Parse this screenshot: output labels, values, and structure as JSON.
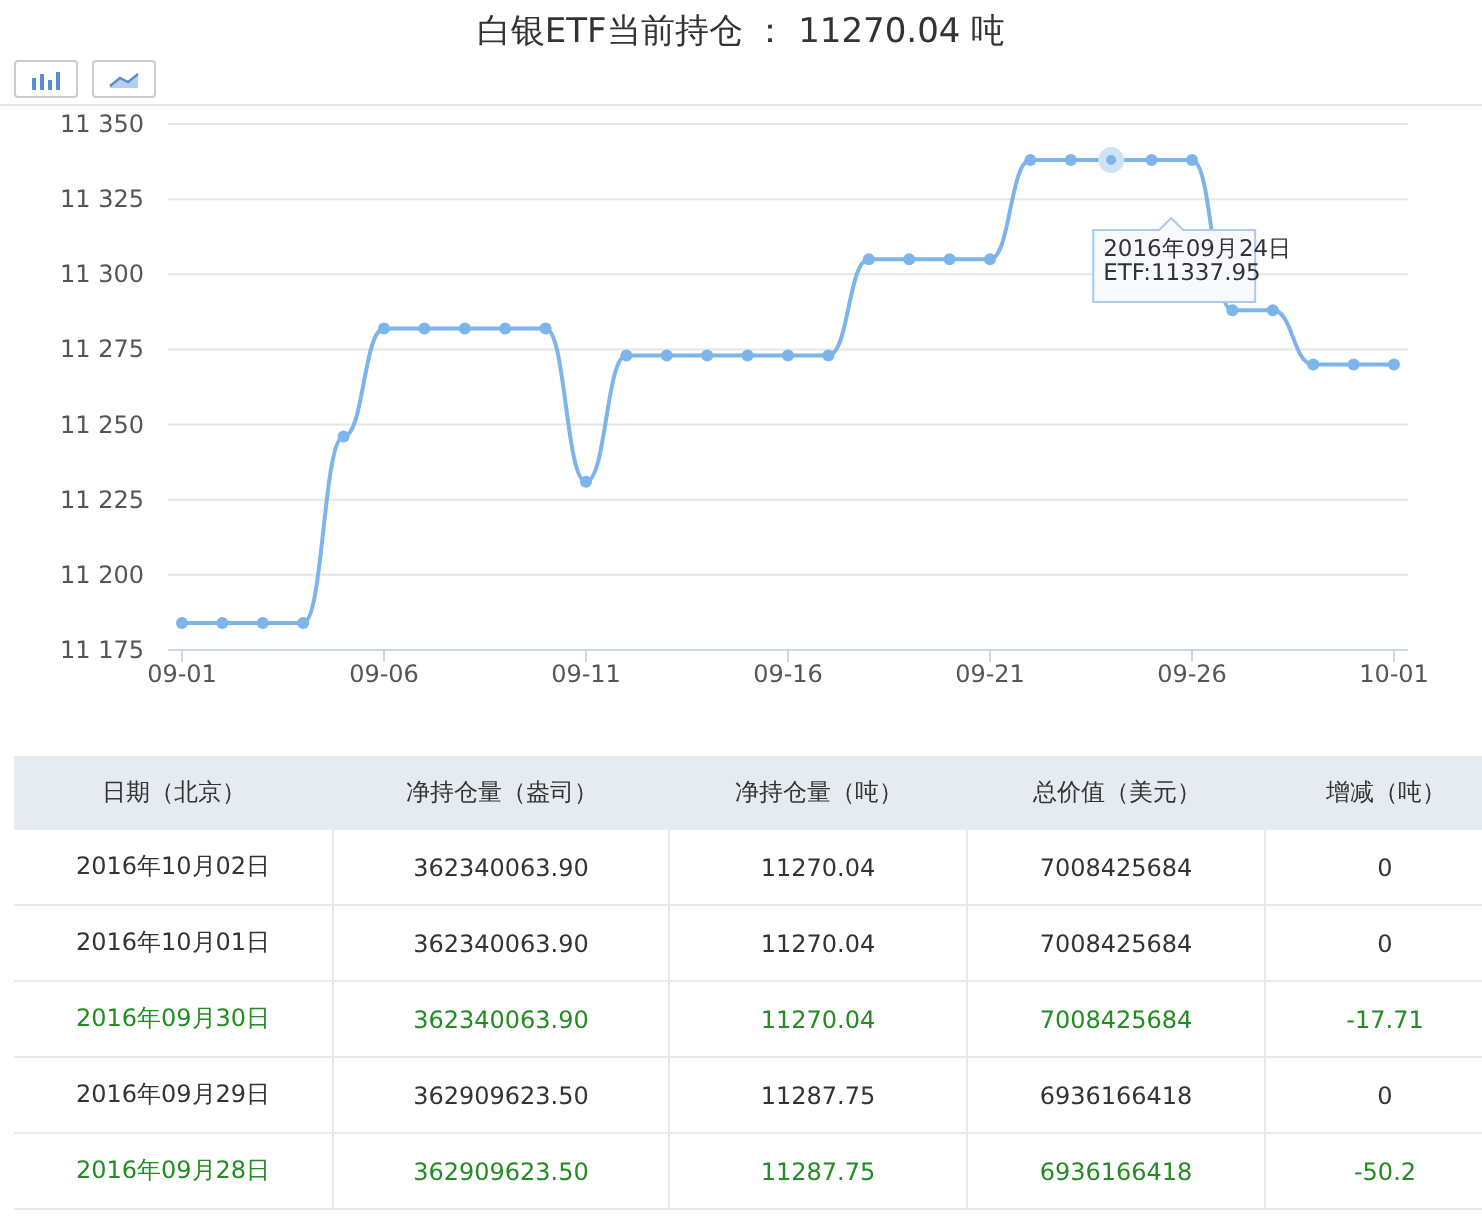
{
  "title": "白银ETF当前持仓 ： 11270.04 吨",
  "toolbar": [
    {
      "kind": "bar",
      "selected": false
    },
    {
      "kind": "line",
      "selected": false
    }
  ],
  "chart": {
    "chart_data": {
      "type": "line",
      "categories": [
        "09-01",
        null,
        null,
        null,
        null,
        "09-06",
        null,
        null,
        null,
        null,
        "09-11",
        null,
        null,
        null,
        null,
        "09-16",
        null,
        null,
        null,
        null,
        "09-21",
        null,
        null,
        null,
        null,
        "09-26",
        null,
        null,
        null,
        null,
        "10-01"
      ],
      "series": [
        {
          "name": "ETF",
          "color": "#7cb5ec",
          "marker": "circle",
          "values": [
            11184,
            11184,
            11184,
            11184,
            11246,
            11282,
            11282,
            11282,
            11282,
            11282,
            11231,
            11273,
            11273,
            11273,
            11273,
            11273,
            11273,
            11305,
            11305,
            11305,
            11305,
            11338,
            11338,
            11338,
            11338,
            11338,
            11288,
            11288,
            11270,
            11270,
            11270
          ]
        }
      ],
      "ylim": [
        11175,
        11350
      ],
      "grid": true,
      "annotations": [
        "2016年09月24日",
        ":11337.95"
      ],
      "yticks": [
        {
          "value": 11175,
          "label": "11 175"
        },
        {
          "value": 11200,
          "label": "11 200"
        },
        {
          "value": 11225,
          "label": "11 225"
        },
        {
          "value": 11250,
          "label": "11 250"
        },
        {
          "value": 11275,
          "label": "11 275"
        },
        {
          "value": 11300,
          "label": "11 300"
        },
        {
          "value": 11325,
          "label": "11 325"
        },
        {
          "value": 11350,
          "label": "11 350"
        }
      ]
    },
    "kind": "line"
  },
  "table": {
    "columns": [
      "日期（北京）",
      "净持仓量（盎司）",
      "净持仓量（吨）",
      "总价值（美元）",
      "增减（吨）"
    ],
    "rows": [
      {
        "color": "#333333",
        "cells": [
          "2016年10月02日",
          "362340063.90",
          "11270.04",
          "7008425684",
          "0"
        ]
      },
      {
        "color": "#333333",
        "cells": [
          "2016年10月01日",
          "362340063.90",
          "11270.04",
          "7008425684",
          "0"
        ]
      },
      {
        "color": "#228b22",
        "cells": [
          "2016年09月30日",
          "362340063.90",
          "11270.04",
          "7008425684",
          "-17.71"
        ]
      },
      {
        "color": "#333333",
        "cells": [
          "2016年09月29日",
          "362909623.50",
          "11287.75",
          "6936166418",
          "0"
        ]
      },
      {
        "color": "#228b22",
        "cells": [
          "2016年09月28日",
          "362909623.50",
          "11287.75",
          "6936166418",
          "-50.2"
        ]
      }
    ]
  }
}
